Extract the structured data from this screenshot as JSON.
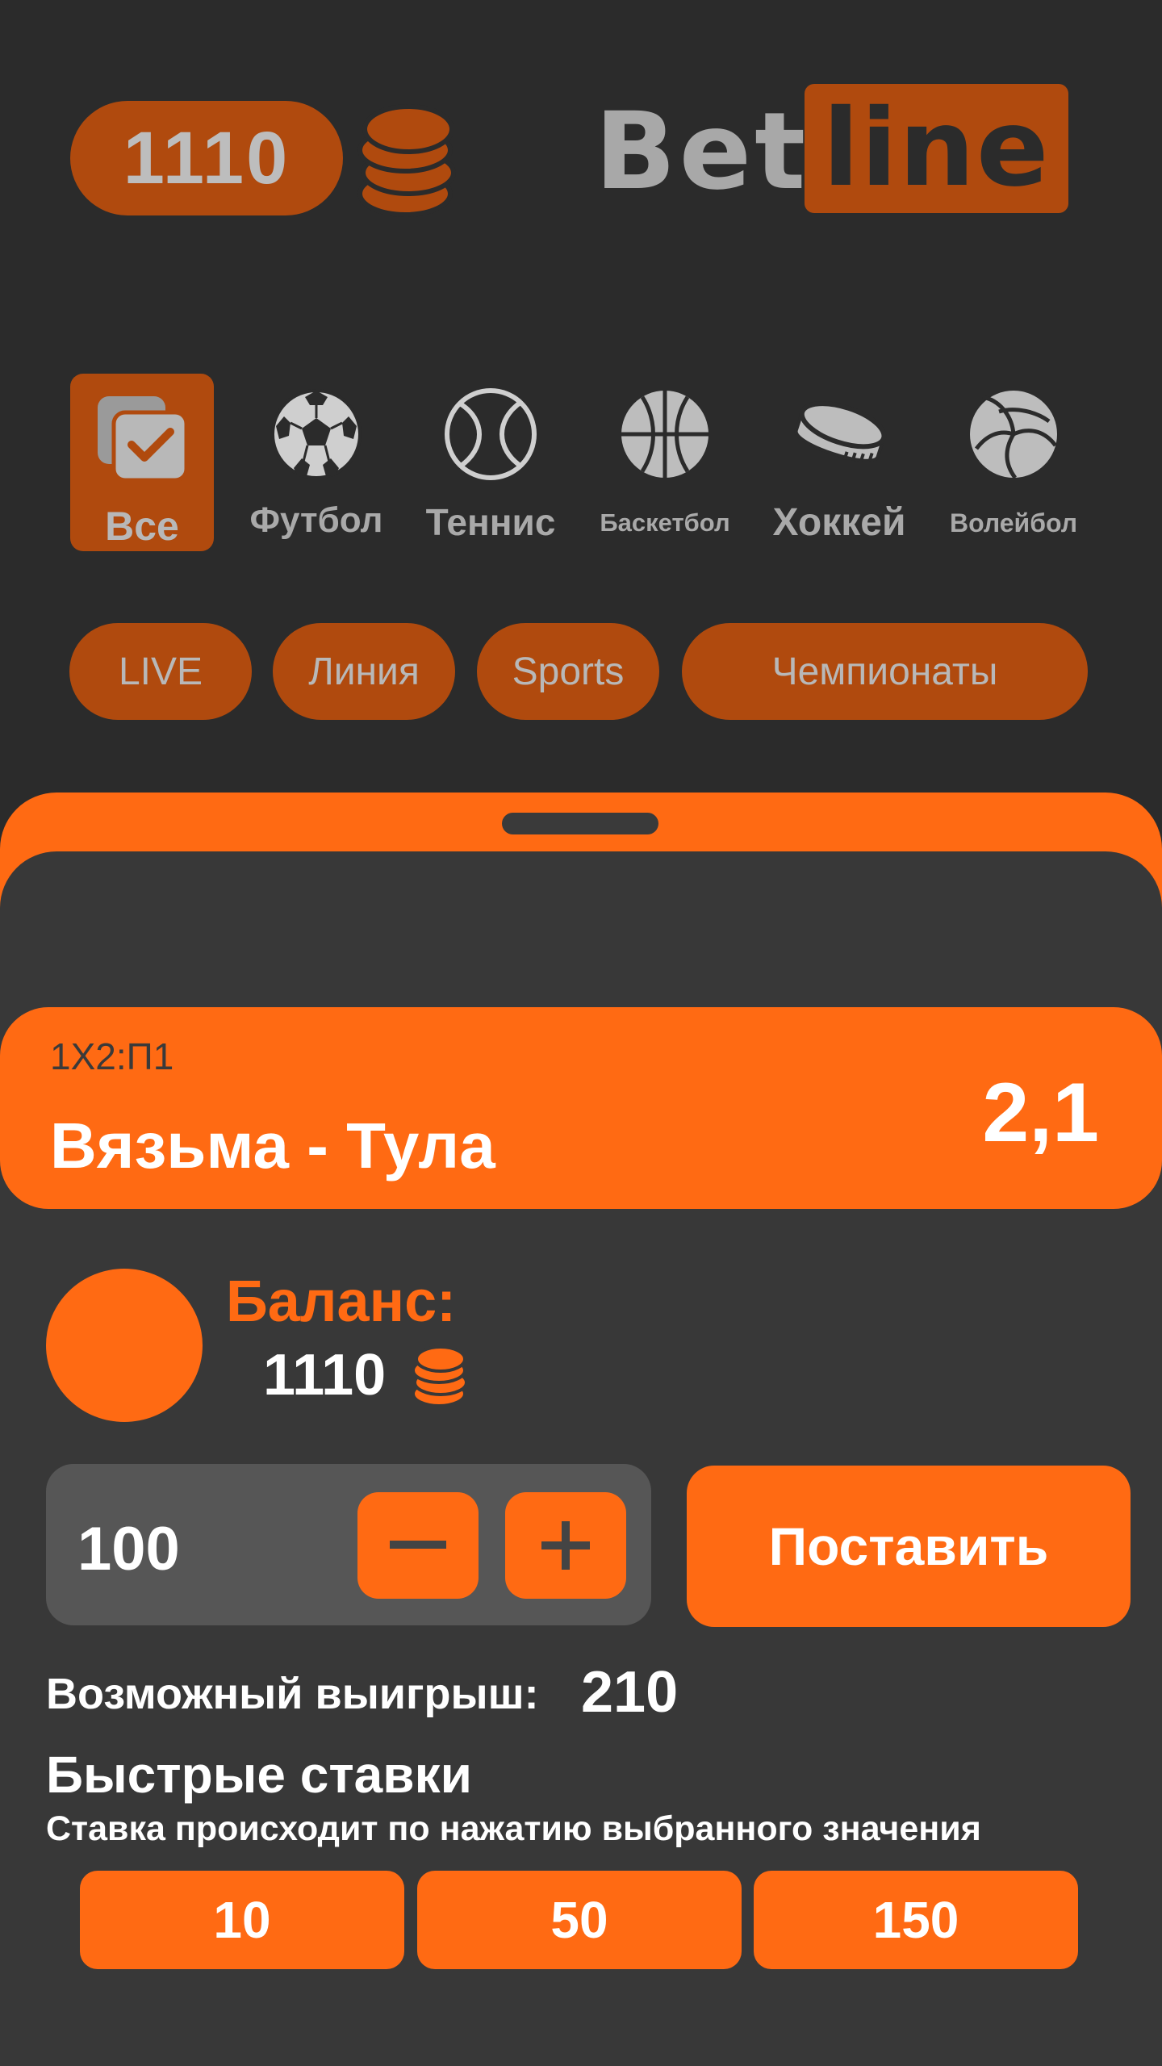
{
  "header": {
    "balance": "1110",
    "coins_icon": "coins-stack-icon",
    "logo_bet": "Bet",
    "logo_line": "line"
  },
  "sports": [
    {
      "label": "Все",
      "icon": "checklist-icon"
    },
    {
      "label": "Футбол",
      "icon": "soccer-ball-icon"
    },
    {
      "label": "Теннис",
      "icon": "tennis-ball-icon"
    },
    {
      "label": "Баскетбол",
      "icon": "basketball-icon"
    },
    {
      "label": "Хоккей",
      "icon": "hockey-puck-icon"
    },
    {
      "label": "Волейбол",
      "icon": "volleyball-icon"
    }
  ],
  "filters": [
    "LIVE",
    "Линия",
    "Sports",
    "Чемпионаты"
  ],
  "bet": {
    "type": "1X2:П1",
    "match": "Вязьма - Тула",
    "odd": "2,1"
  },
  "balance": {
    "label": "Баланс:",
    "value": "1110"
  },
  "stake": {
    "amount": "100",
    "place_label": "Поставить"
  },
  "winnings": {
    "label": "Возможный выигрыш:",
    "value": "210"
  },
  "quick_bets": {
    "title": "Быстрые ставки",
    "subtitle": "Ставка происходит по нажатию выбранного значения",
    "values": [
      "10",
      "50",
      "150"
    ]
  },
  "colors": {
    "accent": "#ff6a13",
    "accent_dark": "#b04a0e",
    "background": "#2b2b2b",
    "sheet": "#383838"
  }
}
